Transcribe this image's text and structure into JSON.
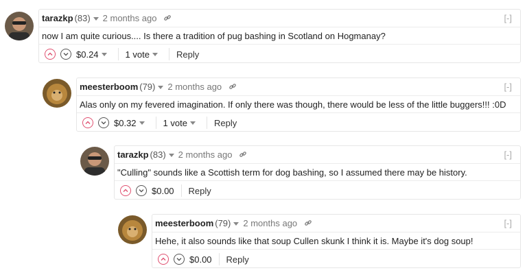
{
  "comments": [
    {
      "author": "tarazkp",
      "reputation": "(83)",
      "time": "2 months ago",
      "collapse": "[-]",
      "body": "now I am quite curious.... Is there a tradition of pug bashing in Scotland on Hogmanay?",
      "payout": "$0.24",
      "votes": "1 vote",
      "reply": "Reply"
    },
    {
      "author": "meesterboom",
      "reputation": "(79)",
      "time": "2 months ago",
      "collapse": "[-]",
      "body": "Alas only on my fevered imagination. If only there was though, there would be less of the little buggers!!! :0D",
      "payout": "$0.32",
      "votes": "1 vote",
      "reply": "Reply"
    },
    {
      "author": "tarazkp",
      "reputation": "(83)",
      "time": "2 months ago",
      "collapse": "[-]",
      "body": "\"Culling\" sounds like a Scottish term for dog bashing, so I assumed there may be history.",
      "payout": "$0.00",
      "reply": "Reply"
    },
    {
      "author": "meesterboom",
      "reputation": "(79)",
      "time": "2 months ago",
      "collapse": "[-]",
      "body": "Hehe, it also sounds like that soup Cullen skunk I think it is. Maybe it's dog soup!",
      "payout": "$0.00",
      "reply": "Reply"
    }
  ],
  "colors": {
    "upvote": "#e05070",
    "border": "#e6e6e6",
    "muted": "#777777"
  },
  "icons": {
    "upvote": "chevron-up-icon",
    "downvote": "chevron-down-icon",
    "permalink": "link-icon",
    "menu": "caret-down-icon"
  }
}
